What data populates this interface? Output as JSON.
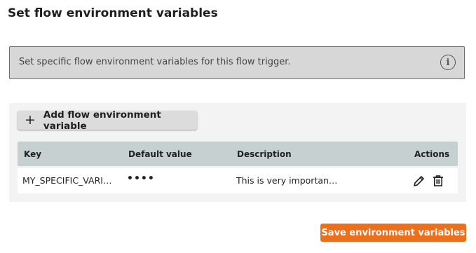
{
  "title": "Set flow environment variables",
  "info": {
    "text": "Set specific flow environment variables for this flow trigger.",
    "icon": "info-icon"
  },
  "add_button": {
    "icon": "plus-icon",
    "label": "Add flow environment variable"
  },
  "table": {
    "columns": [
      "Key",
      "Default value",
      "Description",
      "Actions"
    ],
    "rows": [
      {
        "key": "MY_SPECIFIC_VARI…",
        "default_value": "••••",
        "description": "This is very importan…",
        "actions": [
          "edit-icon",
          "delete-icon"
        ]
      }
    ]
  },
  "save_button": {
    "label": "Save environment variables"
  },
  "colors": {
    "accent": "#ec6f1c",
    "table_header": "#c6d0d0",
    "banner_bg": "#d7d7d7",
    "panel_bg": "#f3f3f3"
  }
}
